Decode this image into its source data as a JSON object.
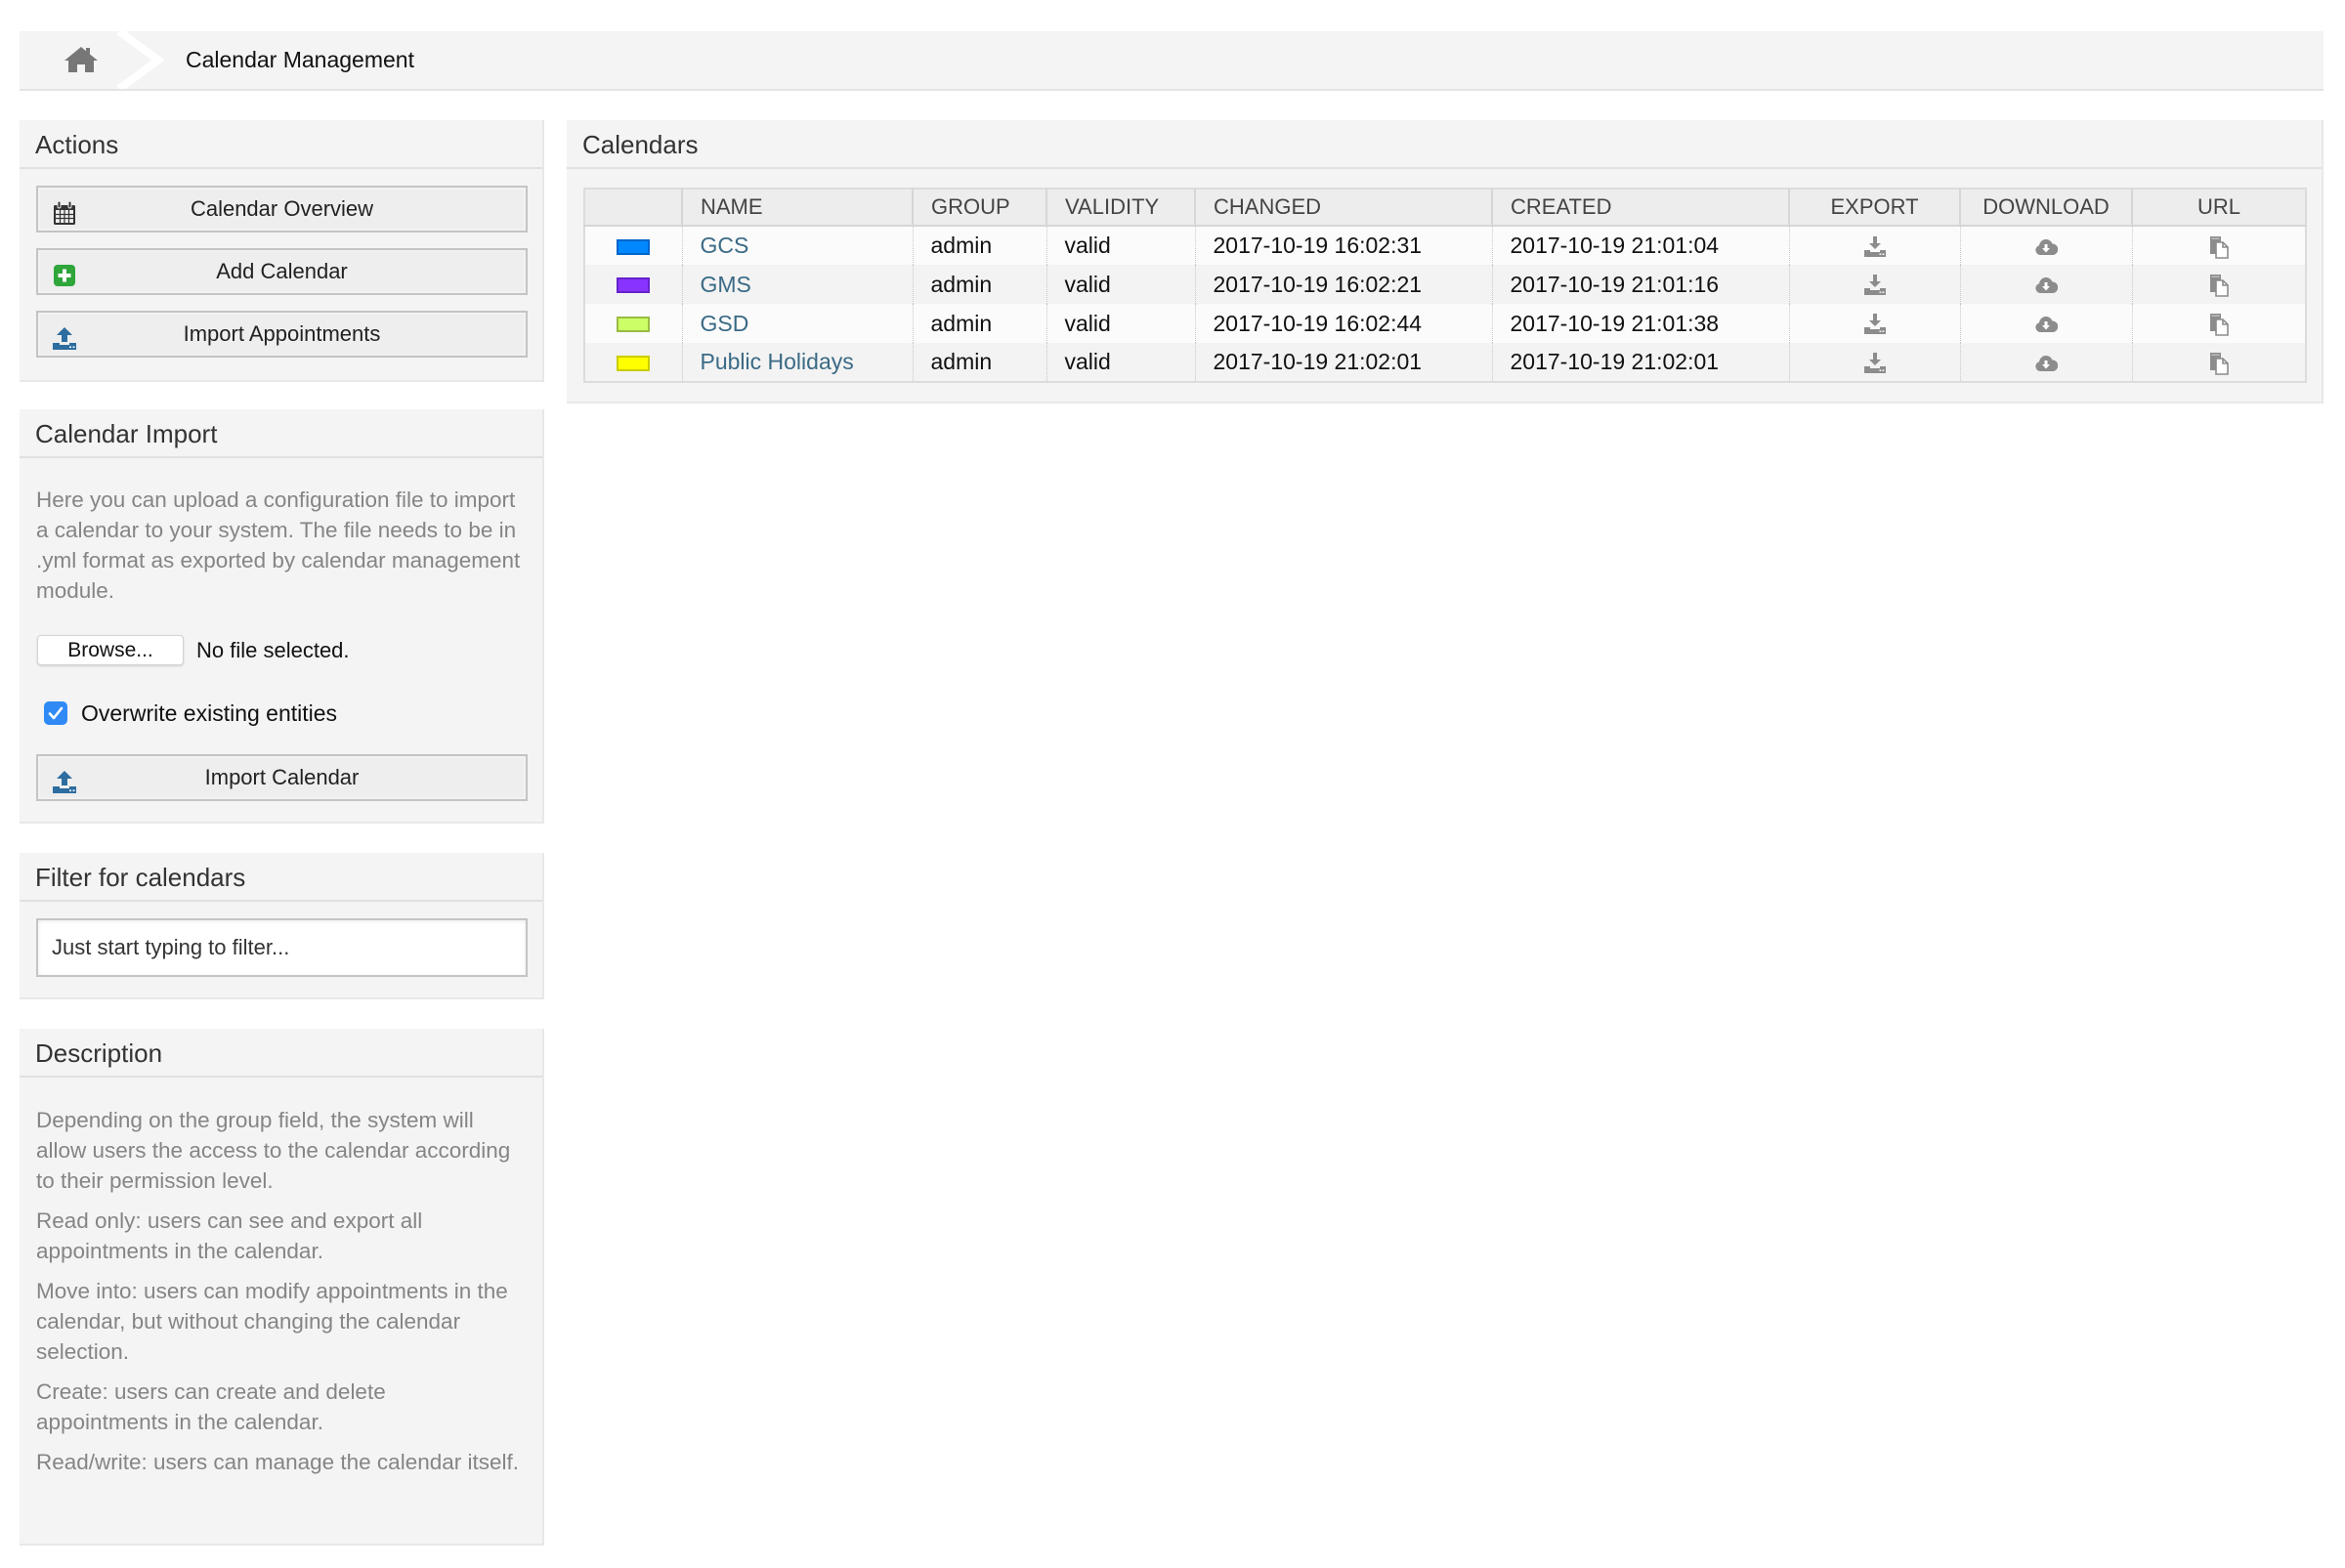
{
  "breadcrumb": {
    "home_icon": "home-icon",
    "current": "Calendar Management"
  },
  "actions": {
    "title": "Actions",
    "buttons": [
      {
        "label": "Calendar Overview",
        "icon": "calendar-icon"
      },
      {
        "label": "Add Calendar",
        "icon": "plus-square-icon"
      },
      {
        "label": "Import Appointments",
        "icon": "upload-icon"
      }
    ]
  },
  "calendar_import": {
    "title": "Calendar Import",
    "description": "Here you can upload a configuration file to import a calendar to your system. The file needs to be in .yml format as exported by calendar management module.",
    "browse_label": "Browse...",
    "file_status": "No file selected.",
    "overwrite_label": "Overwrite existing entities",
    "overwrite_checked": true,
    "import_button": "Import Calendar",
    "import_icon": "upload-icon"
  },
  "filter": {
    "title": "Filter for calendars",
    "placeholder": "Just start typing to filter..."
  },
  "description": {
    "title": "Description",
    "paragraphs": [
      "Depending on the group field, the system will allow users the access to the calendar according to their permission level.",
      "Read only: users can see and export all appointments in the calendar.",
      "Move into: users can modify appointments in the calendar, but without changing the calendar selection.",
      "Create: users can create and delete appointments in the calendar.",
      "Read/write: users can manage the calendar itself."
    ]
  },
  "calendars": {
    "title": "Calendars",
    "columns": [
      "",
      "NAME",
      "GROUP",
      "VALIDITY",
      "CHANGED",
      "CREATED",
      "EXPORT",
      "DOWNLOAD",
      "URL"
    ],
    "rows": [
      {
        "color": "#0088ff",
        "border": "#0066cc",
        "name": "GCS",
        "group": "admin",
        "validity": "valid",
        "changed": "2017-10-19 16:02:31",
        "created": "2017-10-19 21:01:04"
      },
      {
        "color": "#8833ff",
        "border": "#6622cc",
        "name": "GMS",
        "group": "admin",
        "validity": "valid",
        "changed": "2017-10-19 16:02:21",
        "created": "2017-10-19 21:01:16"
      },
      {
        "color": "#ccff66",
        "border": "#99bb44",
        "name": "GSD",
        "group": "admin",
        "validity": "valid",
        "changed": "2017-10-19 16:02:44",
        "created": "2017-10-19 21:01:38"
      },
      {
        "color": "#ffff00",
        "border": "#cccc00",
        "name": "Public Holidays",
        "group": "admin",
        "validity": "valid",
        "changed": "2017-10-19 21:02:01",
        "created": "2017-10-19 21:02:01"
      }
    ],
    "row_icons": {
      "export": "export-download-icon",
      "download": "cloud-download-icon",
      "url": "copy-icon"
    }
  }
}
